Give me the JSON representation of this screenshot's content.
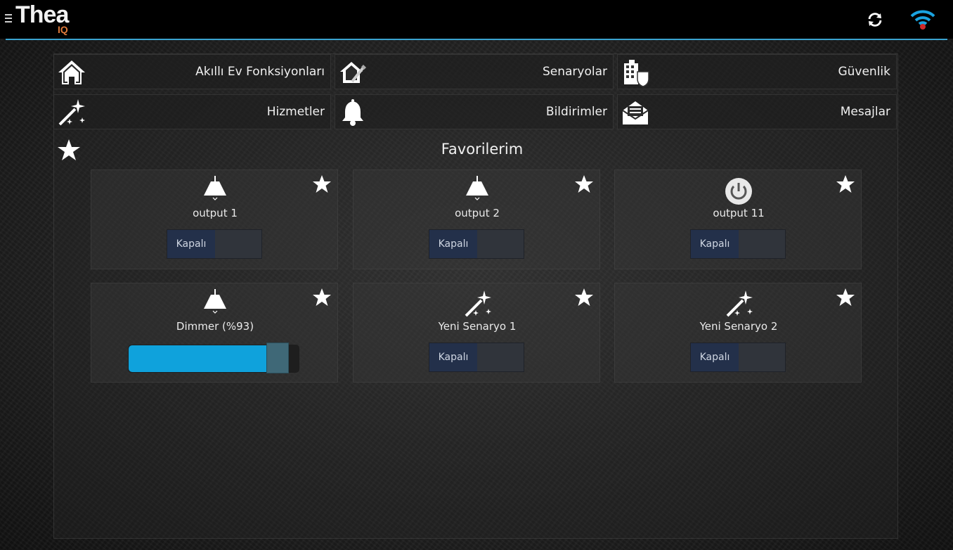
{
  "app": {
    "logo_text": "Thea",
    "logo_sub": "IQ",
    "colors": {
      "accent": "#3aa3d0",
      "logo_accent": "#e07a3a",
      "slider_fill": "#0fa2dc"
    }
  },
  "header": {
    "menu_icon": "hamburger-icon",
    "refresh_icon": "refresh-icon",
    "wifi_icon": "wifi-icon"
  },
  "nav": {
    "items": [
      {
        "label": "Akıllı Ev Fonksiyonları",
        "icon": "house-icon"
      },
      {
        "label": "Senaryolar",
        "icon": "house-edit-icon"
      },
      {
        "label": "Güvenlik",
        "icon": "building-shield-icon"
      },
      {
        "label": "Hizmetler",
        "icon": "magic-wand-icon"
      },
      {
        "label": "Bildirimler",
        "icon": "bell-icon"
      },
      {
        "label": "Mesajlar",
        "icon": "envelope-icon"
      }
    ]
  },
  "favorites": {
    "title": "Favorilerim",
    "cards": [
      {
        "name": "output 1",
        "icon": "lamp-icon",
        "state": "Kapalı"
      },
      {
        "name": "output 2",
        "icon": "lamp-icon",
        "state": "Kapalı"
      },
      {
        "name": "output 11",
        "icon": "power-icon",
        "state": "Kapalı"
      },
      {
        "name": "Dimmer (%93)",
        "icon": "lamp-icon",
        "level": 0.93
      },
      {
        "name": "Yeni Senaryo 1",
        "icon": "magic-wand-icon",
        "state": "Kapalı"
      },
      {
        "name": "Yeni Senaryo 2",
        "icon": "magic-wand-icon",
        "state": "Kapalı"
      }
    ]
  }
}
